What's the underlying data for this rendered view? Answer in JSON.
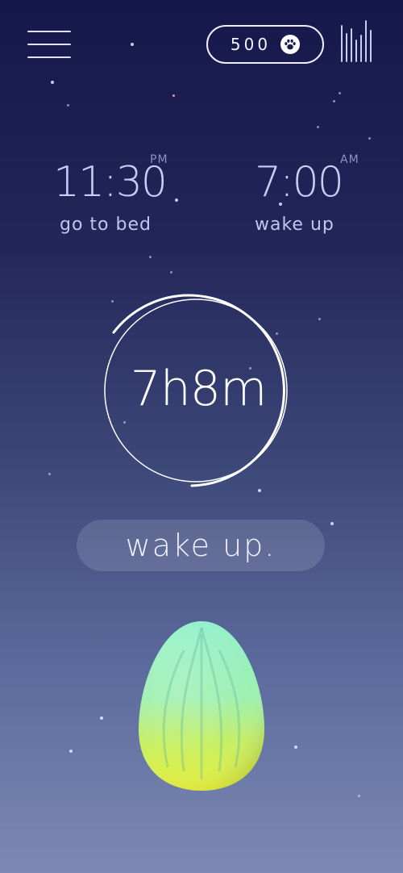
{
  "colors": {
    "background_top": "#16174a",
    "background_bottom": "#7c89b5",
    "egg_top": "#8ef0c9",
    "egg_bottom": "#e6ef3c"
  },
  "header": {
    "menu_icon": "hamburger-menu-icon",
    "points": "500",
    "points_icon": "paw-icon",
    "stats_icon": "bar-stats-icon"
  },
  "schedule": {
    "bedtime": {
      "time": "11:30",
      "period": "PM",
      "label": "go to bed"
    },
    "wake": {
      "time": "7:00",
      "period": "AM",
      "label": "wake up"
    }
  },
  "dial": {
    "duration": "7h8m"
  },
  "action": {
    "label": "wake up."
  },
  "pet": {
    "icon": "egg-icon"
  }
}
